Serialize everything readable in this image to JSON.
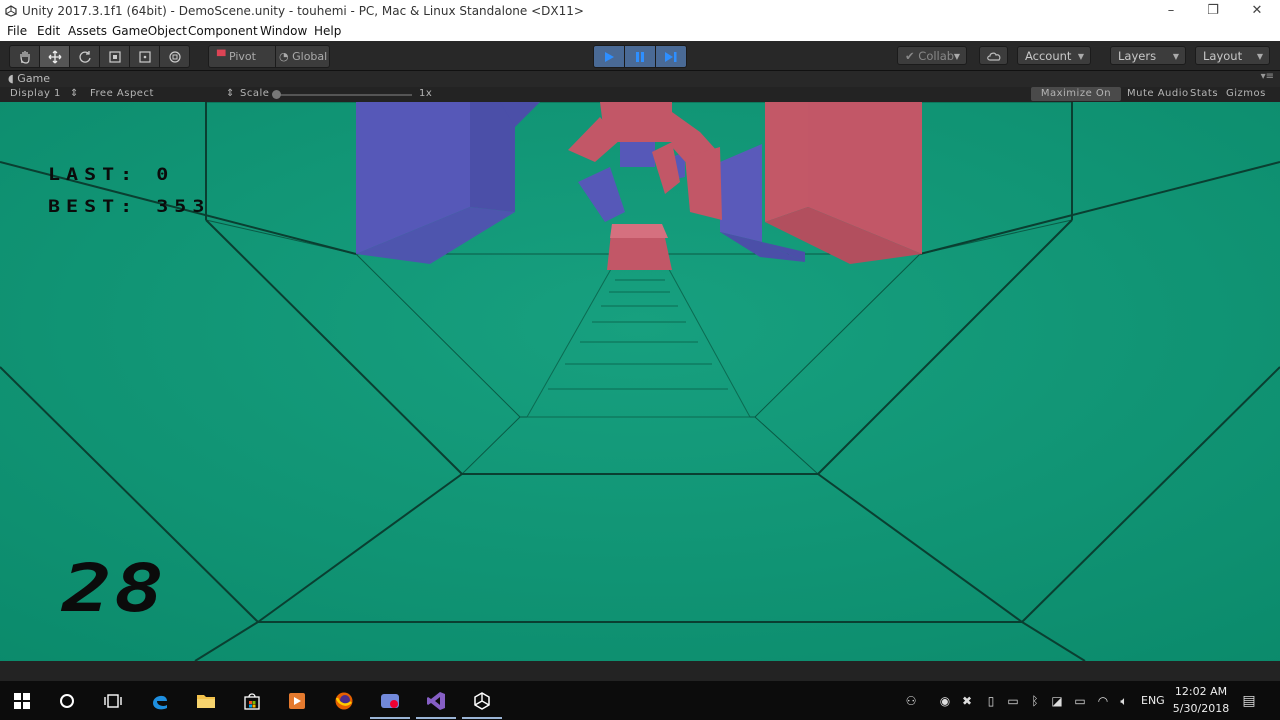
{
  "window": {
    "title": "Unity 2017.3.1f1 (64bit) - DemoScene.unity - touhemi - PC, Mac & Linux Standalone <DX11>",
    "controls": {
      "minimize": "–",
      "restore": "❐",
      "close": "✕"
    }
  },
  "menu": {
    "items": [
      "File",
      "Edit",
      "Assets",
      "GameObject",
      "Component",
      "Window",
      "Help"
    ]
  },
  "toolbar": {
    "pivot_label": "Pivot",
    "global_label": "Global",
    "collab_label": "Collab",
    "account_label": "Account",
    "layers_label": "Layers",
    "layout_label": "Layout",
    "caret": "▼",
    "accent_color": "#4a6a95"
  },
  "tab": {
    "label": "Game",
    "menu_glyph": "▾≡"
  },
  "game_toolbar": {
    "display": "Display 1",
    "aspect": "Free Aspect",
    "scale_label": "Scale",
    "scale_value": "1x",
    "maximize_on_play": "Maximize On Play",
    "mute_audio": "Mute Audio",
    "stats": "Stats",
    "gizmos": "Gizmos"
  },
  "game": {
    "last_label": "LAST:",
    "last_value": "0",
    "best_label": "BEST:",
    "best_value": "353",
    "speed": "28",
    "tunnel_color": "#0f9877",
    "red_block_color": "#c25767",
    "blue_block_color": "#5a5aba"
  },
  "taskbar": {
    "language": "ENG",
    "time": "12:02 AM",
    "date": "5/30/2018"
  }
}
